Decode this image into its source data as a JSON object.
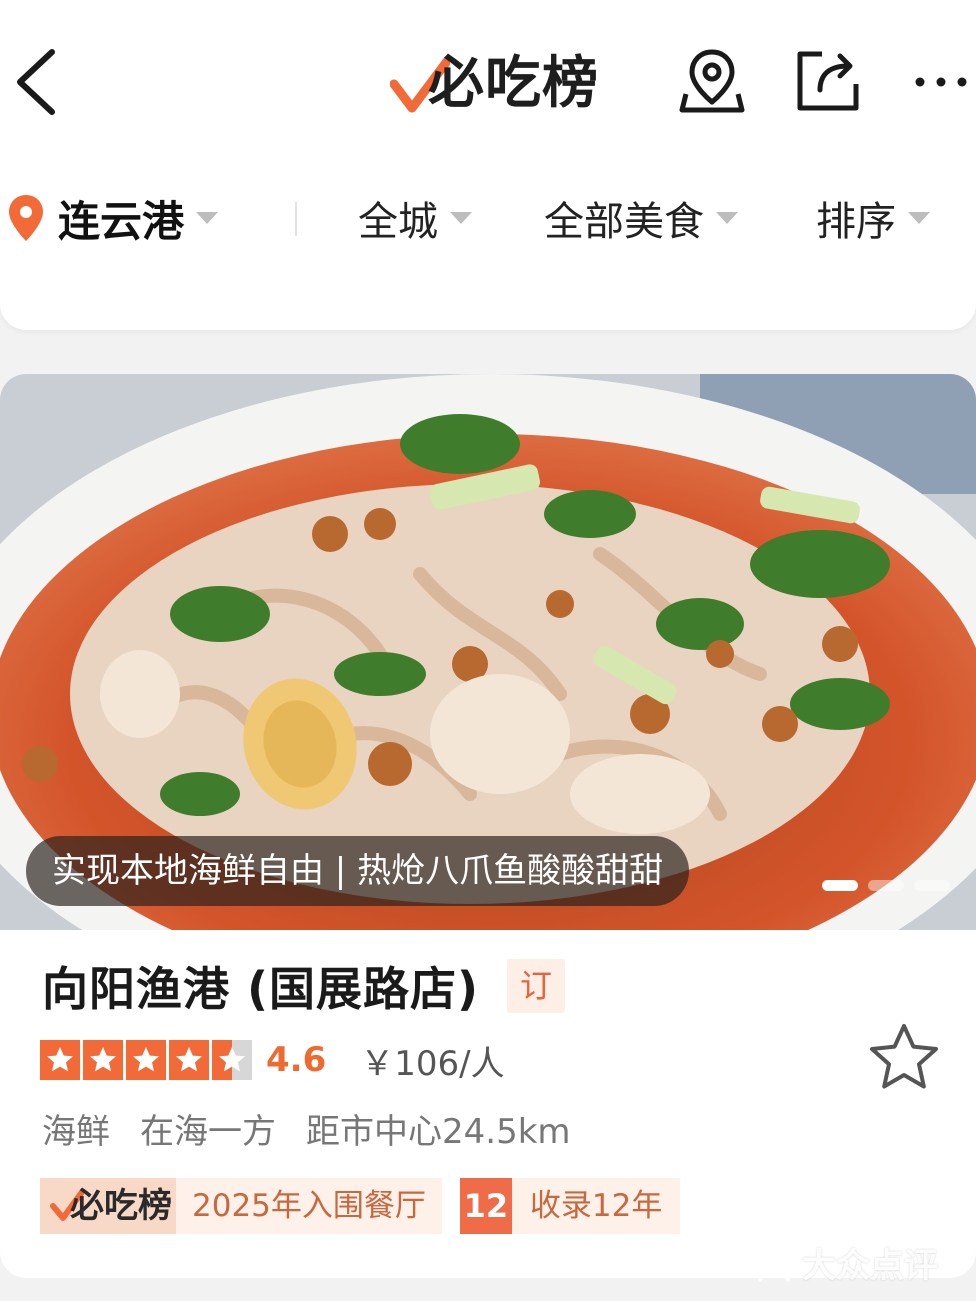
{
  "nav": {
    "logo_text": "必吃榜",
    "back_icon": "chevron-left-icon",
    "map_icon": "map-pin-icon",
    "share_icon": "share-icon",
    "more_icon": "more-icon"
  },
  "filters": {
    "city": "连云港",
    "area": "全城",
    "category": "全部美食",
    "sort": "排序"
  },
  "shop": {
    "photo_caption": "实现本地海鲜自由 | 热炝八爪鱼酸酸甜甜",
    "carousel": {
      "count": 3,
      "active_index": 0
    },
    "name": "向阳渔港 (国展路店)",
    "reserve_badge": "订",
    "stars": 4.6,
    "rating": "4.6",
    "price": "￥106/人",
    "cuisine": "海鲜",
    "district": "在海一方",
    "distance": "距市中心24.5km",
    "list_logo": "必吃榜",
    "list_tag": "2025年入围餐厅",
    "years_number": "12",
    "years_text": "收录12年"
  },
  "watermark": "大众点评",
  "colors": {
    "accent": "#f26a38",
    "tag_text": "#c9683e",
    "tag_bg": "#fdf1ea"
  }
}
